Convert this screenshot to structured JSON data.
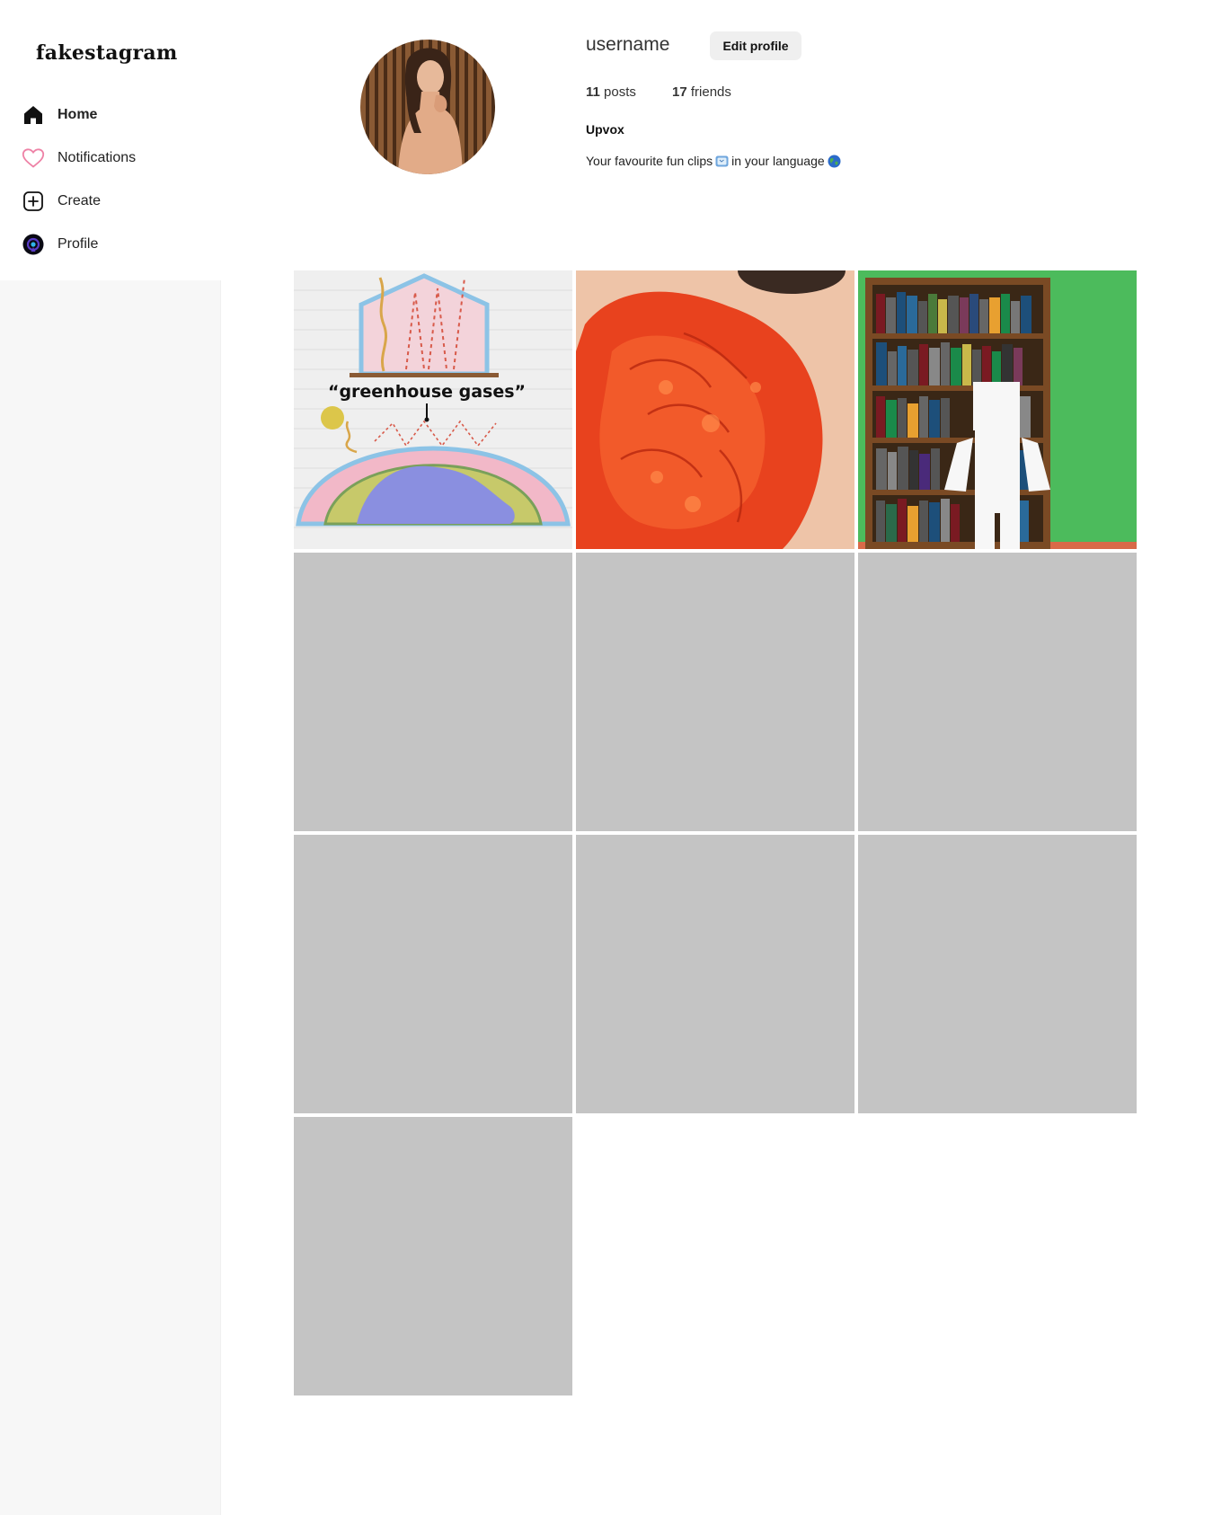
{
  "app": {
    "logo": "fakestagram"
  },
  "sidebar": {
    "items": [
      {
        "label": "Home",
        "icon": "home-icon",
        "active": true
      },
      {
        "label": "Notifications",
        "icon": "heart-icon",
        "active": false
      },
      {
        "label": "Create",
        "icon": "plus-square-icon",
        "active": false
      },
      {
        "label": "Profile",
        "icon": "profile-avatar-icon",
        "active": false
      }
    ]
  },
  "profile": {
    "username": "username",
    "edit_button": "Edit profile",
    "posts_count": "11",
    "posts_label": "posts",
    "friends_count": "17",
    "friends_label": "friends",
    "display_name": "Upvox",
    "bio_before": "Your favourite fun clips",
    "bio_after": "in your language",
    "bio_icons": [
      "tv-emoji-icon",
      "globe-emoji-icon"
    ]
  },
  "posts": {
    "items": [
      {
        "thumb": "greenhouse-diagram",
        "caption_text": "“greenhouse gases”"
      },
      {
        "thumb": "red-paint-texture"
      },
      {
        "thumb": "bookshelf-robot"
      },
      {
        "thumb": "placeholder"
      },
      {
        "thumb": "placeholder"
      },
      {
        "thumb": "placeholder"
      },
      {
        "thumb": "placeholder"
      },
      {
        "thumb": "placeholder"
      },
      {
        "thumb": "placeholder"
      },
      {
        "thumb": "placeholder"
      }
    ]
  },
  "colors": {
    "placeholder_tile": "#c4c4c4",
    "sidebar_bg": "#f7f7f7",
    "edit_button_bg": "#efefef",
    "heart_icon": "#ee82a6",
    "profile_icon": "#5a3cc8"
  }
}
